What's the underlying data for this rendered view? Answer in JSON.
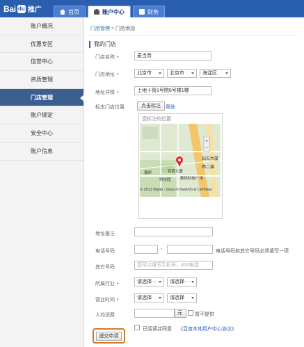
{
  "header": {
    "logo_text": "Bai",
    "logo_mark": "du",
    "logo_sub": "推广",
    "tabs": [
      {
        "label": "首页",
        "icon": "home-icon"
      },
      {
        "label": "账户中心",
        "icon": "user-icon",
        "active": true
      },
      {
        "label": "财务",
        "icon": "money-icon"
      }
    ]
  },
  "sidebar": {
    "items": [
      {
        "label": "账户概况"
      },
      {
        "label": "优惠专区"
      },
      {
        "label": "信誉中心"
      },
      {
        "label": "资质管理"
      },
      {
        "label": "门店管理",
        "active": true
      },
      {
        "label": "账户绑定"
      },
      {
        "label": "安全中心"
      },
      {
        "label": "账户信息"
      }
    ]
  },
  "breadcrumb": {
    "parent": "门店管理",
    "sep": ">",
    "current": "门店添加"
  },
  "section_title": "我的门店",
  "form": {
    "name_label": "门店名称",
    "name_value": "麦当劳",
    "addr_label": "门店地址",
    "province": "北京市",
    "city": "北京市",
    "district": "海淀区",
    "detail_label": "地址详情",
    "detail_value": "上地十街1号院6号楼1楼",
    "mark_label": "标志门店位置",
    "mark_button": "点击标注",
    "help_link": "帮助",
    "map_hint": "您标注的位置",
    "map_copy": "© 2013 Baidu - Data © NavInfo & CenNavi",
    "map_labels": [
      "钻石大厦",
      "西二旗",
      "德邦",
      "科技园",
      "百度大厦",
      "数码科技广场",
      "+",
      "−"
    ],
    "addr_note_label": "地址备注",
    "phone_label": "电话号码",
    "phone_dash": "-",
    "phone_note": "电话号码和其它号码必须填写一项",
    "other_label": "其它号码",
    "other_placeholder": "您可以填写手机号、400电话",
    "industry_label": "所属行业",
    "industry_1": "请选择···",
    "industry_2": "请选择···",
    "hours_label": "营业时间",
    "hours_1": "请选择",
    "hours_2": "请选择",
    "avg_label": "人均消费",
    "avg_unit": "元",
    "not_provided": "暂不提供",
    "agree_text": "已阅读并同意",
    "agree_link": "《百度本地用户中心协议》",
    "submit": "提交申请"
  },
  "colors": {
    "brand": "#2a5fb0",
    "sidebar_active": "#3c5f91",
    "highlight": "#d17a26",
    "required": "#e33333"
  }
}
